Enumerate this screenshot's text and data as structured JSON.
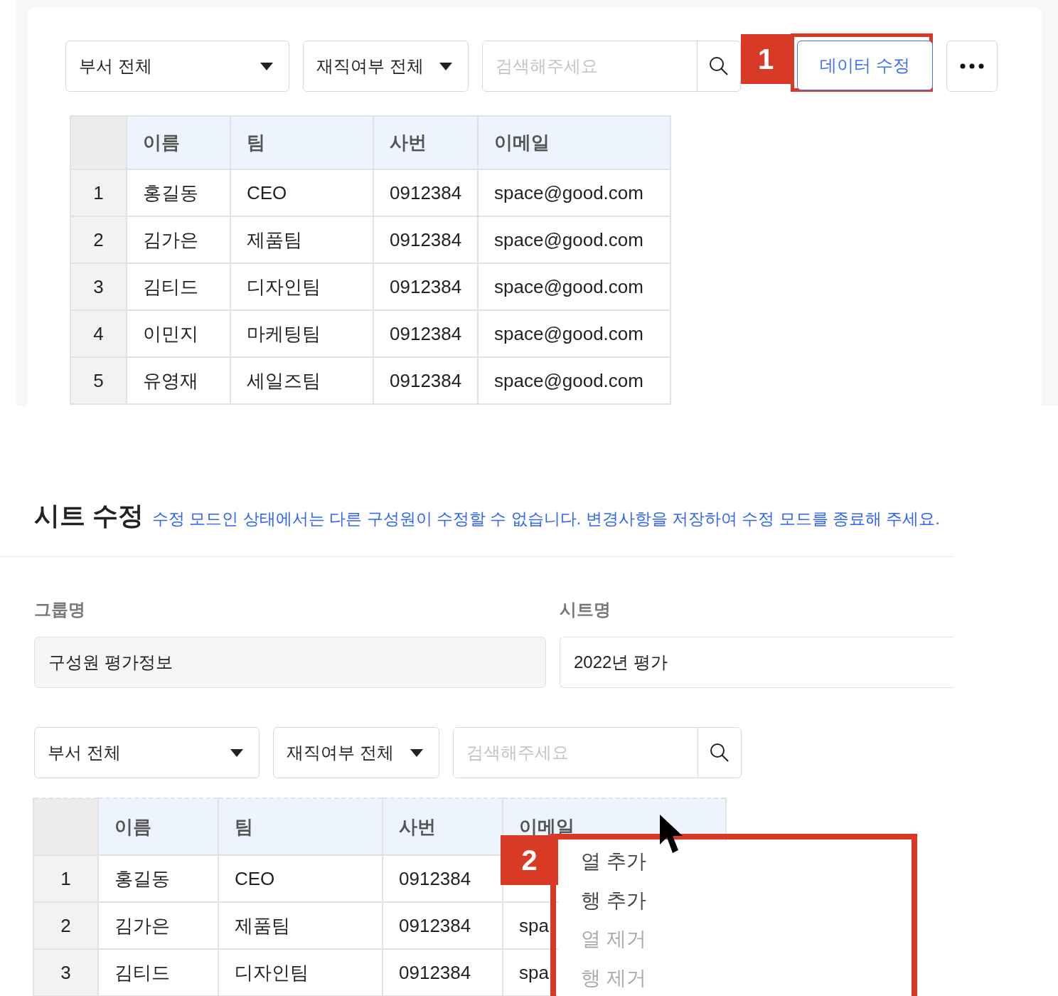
{
  "top_panel": {
    "filters": [
      {
        "label": "부서 전체"
      },
      {
        "label": "재직여부 전체"
      }
    ],
    "search": {
      "placeholder": "검색해주세요"
    },
    "edit_button": "데이터 수정",
    "marker": "1",
    "table": {
      "columns": [
        "이름",
        "팀",
        "사번",
        "이메일"
      ],
      "rows": [
        {
          "index": "1",
          "cells": [
            "홍길동",
            "CEO",
            "0912384",
            "space@good.com"
          ]
        },
        {
          "index": "2",
          "cells": [
            "김가은",
            "제품팀",
            "0912384",
            "space@good.com"
          ]
        },
        {
          "index": "3",
          "cells": [
            "김티드",
            "디자인팀",
            "0912384",
            "space@good.com"
          ]
        },
        {
          "index": "4",
          "cells": [
            "이민지",
            "마케팅팀",
            "0912384",
            "space@good.com"
          ]
        },
        {
          "index": "5",
          "cells": [
            "유영재",
            "세일즈팀",
            "0912384",
            "space@good.com"
          ]
        }
      ]
    }
  },
  "sheet_edit": {
    "title": "시트 수정",
    "notice": "수정 모드인 상태에서는 다른 구성원이 수정할 수 없습니다. 변경사항을 저장하여 수정 모드를 종료해 주세요.",
    "group": {
      "label": "그룹명",
      "value": "구성원 평가정보"
    },
    "sheet": {
      "label": "시트명",
      "value": "2022년 평가"
    },
    "filters": [
      {
        "label": "부서 전체"
      },
      {
        "label": "재직여부 전체"
      }
    ],
    "search": {
      "placeholder": "검색해주세요"
    },
    "table": {
      "columns": [
        "이름",
        "팀",
        "사번",
        "이메일"
      ],
      "rows": [
        {
          "index": "1",
          "cells": [
            "홍길동",
            "CEO",
            "0912384"
          ]
        },
        {
          "index": "2",
          "cells": [
            "김가은",
            "제품팀",
            "0912384",
            "spa"
          ]
        },
        {
          "index": "3",
          "cells": [
            "김티드",
            "디자인팀",
            "0912384",
            "spa"
          ]
        }
      ]
    },
    "context_menu": {
      "marker": "2",
      "items": [
        {
          "label": "열 추가",
          "disabled": false
        },
        {
          "label": "행 추가",
          "disabled": false
        },
        {
          "label": "열 제거",
          "disabled": true
        },
        {
          "label": "행 제거",
          "disabled": true
        }
      ]
    }
  }
}
